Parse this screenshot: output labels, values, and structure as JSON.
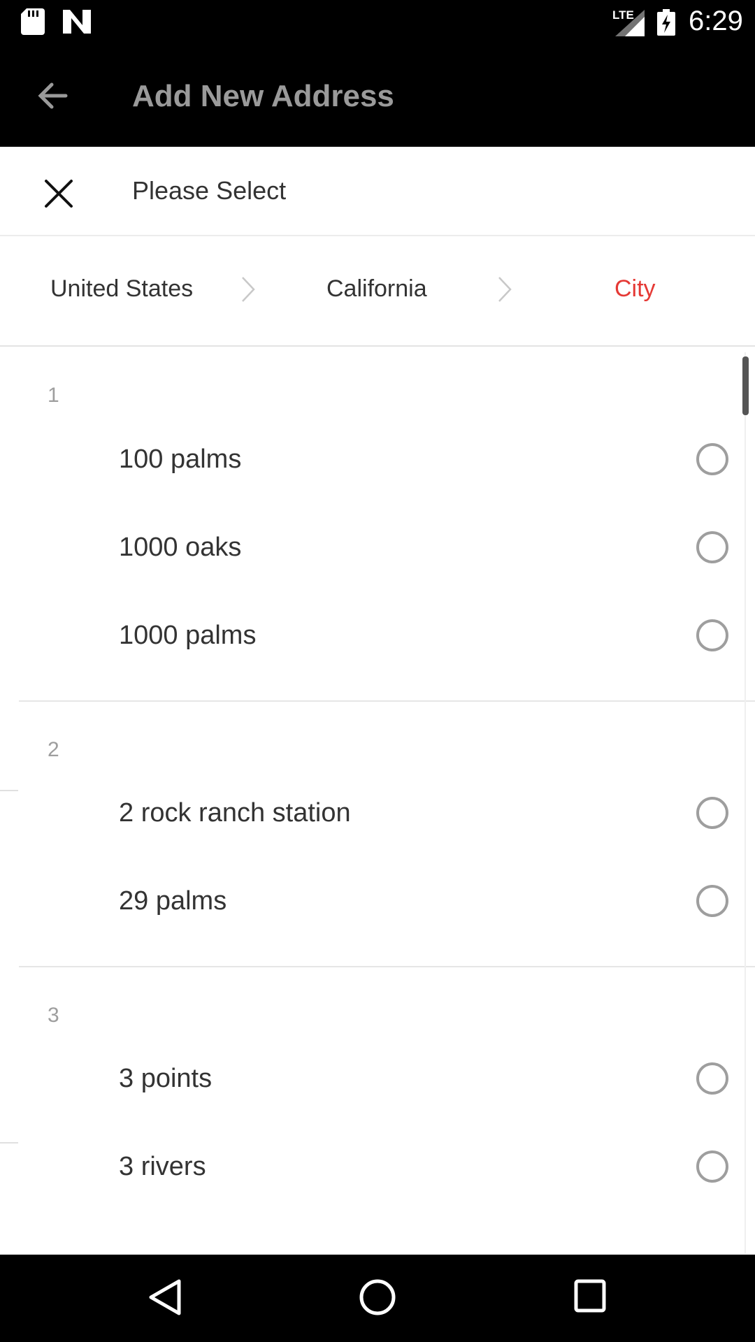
{
  "status_bar": {
    "time": "6:29",
    "network": "LTE"
  },
  "app_bar": {
    "title": "Add New Address"
  },
  "sheet": {
    "title": "Please Select",
    "breadcrumbs": [
      "United States",
      "California",
      "City"
    ]
  },
  "groups": [
    {
      "label": "1",
      "items": [
        "100 palms",
        "1000 oaks",
        "1000 palms"
      ]
    },
    {
      "label": "2",
      "items": [
        "2 rock ranch station",
        "29 palms"
      ]
    },
    {
      "label": "3",
      "items": [
        "3 points",
        "3 rivers"
      ]
    }
  ],
  "colors": {
    "accent": "#e53935",
    "bars": "#000000",
    "radio": "#9e9e9e"
  },
  "icons": {
    "back": "arrow-left-icon",
    "close": "close-icon",
    "chevron": "chevron-right-icon",
    "nav_back": "triangle-back-icon",
    "nav_home": "circle-home-icon",
    "nav_recent": "square-recent-icon"
  }
}
